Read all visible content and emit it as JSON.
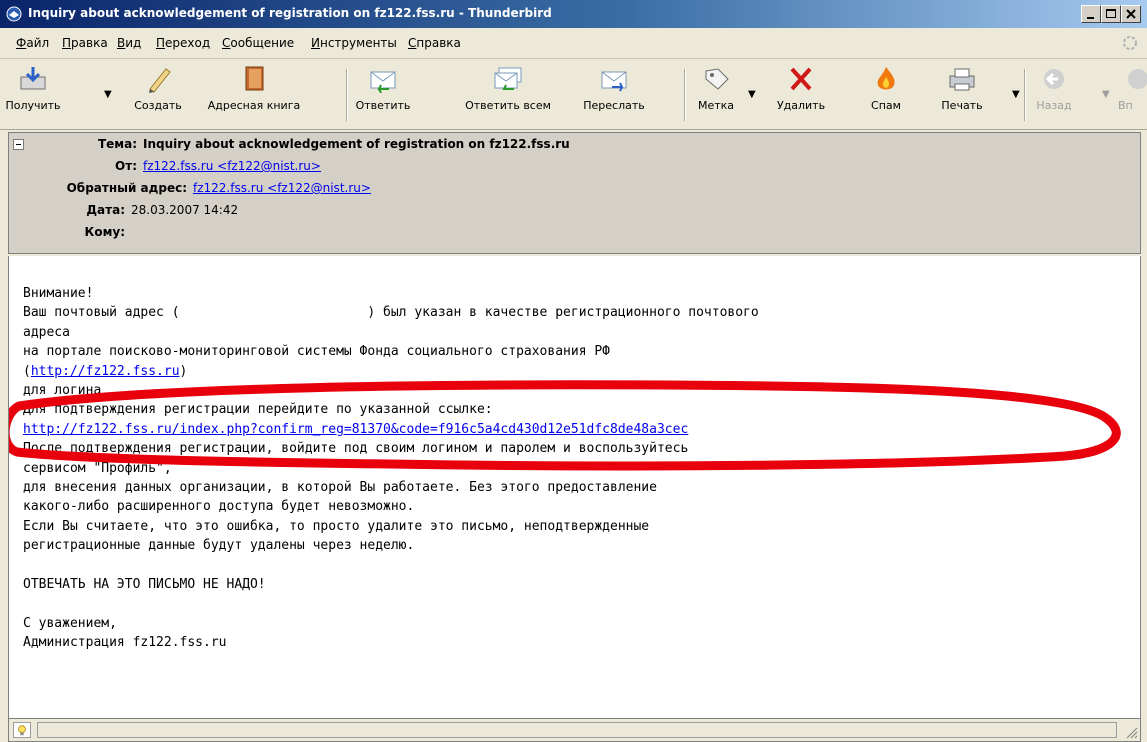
{
  "window": {
    "title": "Inquiry about acknowledgement of registration on fz122.fss.ru - Thunderbird"
  },
  "menu": {
    "items": [
      {
        "first": "Ф",
        "rest": "айл"
      },
      {
        "first": "П",
        "rest": "равка"
      },
      {
        "first": "В",
        "rest": "ид"
      },
      {
        "first": "П",
        "rest": "ереход"
      },
      {
        "first": "С",
        "rest": "ообщение"
      },
      {
        "first": "И",
        "rest": "нструменты"
      },
      {
        "first": "С",
        "rest": "правка"
      }
    ]
  },
  "toolbar": {
    "get": "Получить",
    "compose": "Создать",
    "addressbook": "Адресная книга",
    "reply": "Ответить",
    "replyall": "Ответить всем",
    "forward": "Переслать",
    "tag": "Метка",
    "delete": "Удалить",
    "junk": "Спам",
    "print": "Печать",
    "back": "Назад",
    "forward_nav": "Вп"
  },
  "header": {
    "subject_label": "Тема:",
    "subject": "Inquiry about acknowledgement of registration on fz122.fss.ru",
    "from_label": "От:",
    "from": "fz122.fss.ru <fz122@nist.ru>",
    "replyto_label": "Обратный адрес:",
    "replyto": "fz122.fss.ru <fz122@nist.ru>",
    "date_label": "Дата:",
    "date": "28.03.2007 14:42",
    "to_label": "Кому:"
  },
  "body": {
    "l1": "Внимание!",
    "l2": "Ваш почтовый адрес (                        ) был указан в качестве регистрационного почтового",
    "l3": "адреса",
    "l4": "на портале поисково-мониторинговой системы Фонда социального страхования РФ",
    "l5_pre": "(",
    "l5_link": "http://fz122.fss.ru",
    "l5_post": ")",
    "l6": "для логина        .",
    "l7": "Для подтверждения регистрации перейдите по указанной ссылке:",
    "l8_link": "http://fz122.fss.ru/index.php?confirm_reg=81370&code=f916c5a4cd430d12e51dfc8de48a3cec",
    "l9": "После подтверждения регистрации, войдите под своим логином и паролем и воспользуйтесь",
    "l10": "сервисом \"Профиль\",",
    "l11": "для внесения данных организации, в которой Вы работаете. Без этого предоставление",
    "l12": "какого-либо расширенного доступа будет невозможно.",
    "l13": "Если Вы считаете, что это ошибка, то просто удалите это письмо, неподтвержденные",
    "l14": "регистрационные данные будут удалены через неделю.",
    "l15": "",
    "l16": "ОТВЕЧАТЬ НА ЭТО ПИСЬМО НЕ НАДО!",
    "l17": "",
    "l18": "С уважением,",
    "l19": "Администрация fz122.fss.ru"
  },
  "colors": {
    "annotation": "#e8000c",
    "link": "#0000ee"
  }
}
